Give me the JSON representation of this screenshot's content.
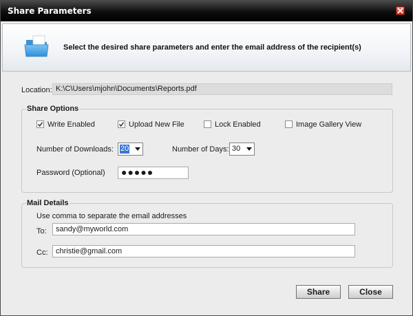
{
  "window": {
    "title": "Share Parameters"
  },
  "header": {
    "instruction": "Select the desired share parameters and enter the email address of the recipient(s)",
    "icon": "folder-icon"
  },
  "location": {
    "label": "Location:",
    "value": "K:\\C\\Users\\mjohn\\Documents\\Reports.pdf"
  },
  "share_options": {
    "legend": "Share Options",
    "checkboxes": [
      {
        "label": "Write Enabled",
        "checked": true
      },
      {
        "label": "Upload New File",
        "checked": true
      },
      {
        "label": "Lock Enabled",
        "checked": false
      },
      {
        "label": "Image Gallery View",
        "checked": false
      }
    ],
    "downloads_label": "Number of Downloads:",
    "downloads_value": "20",
    "days_label": "Number of Days:",
    "days_value": "30",
    "password_label": "Password (Optional)",
    "password_value": "●●●●●"
  },
  "mail_details": {
    "legend": "Mail Details",
    "hint": "Use comma to separate the email addresses",
    "to_label": "To:",
    "to_value": "sandy@myworld.com",
    "cc_label": "Cc:",
    "cc_value": "christie@gmail.com"
  },
  "buttons": {
    "share_label": "Share",
    "close_label": "Close"
  },
  "colors": {
    "title_bar": "#000000",
    "close_button": "#d83a2a",
    "selection": "#3875d7"
  }
}
